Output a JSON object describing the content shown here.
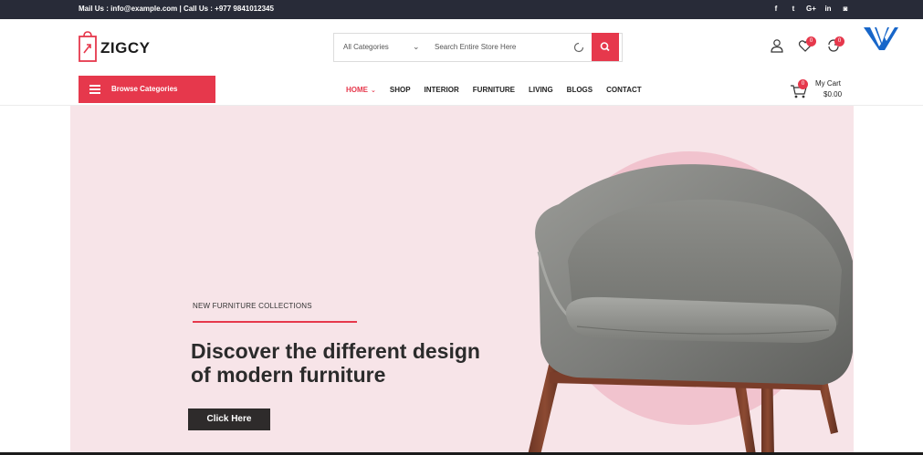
{
  "topbar": {
    "contact_text": "Mail Us : info@example.com | Call Us : +977 9841012345",
    "social": [
      {
        "icon": "facebook-icon",
        "glyph": "f"
      },
      {
        "icon": "twitter-icon",
        "glyph": "t"
      },
      {
        "icon": "google-plus-icon",
        "glyph": "G+"
      },
      {
        "icon": "linkedin-icon",
        "glyph": "in"
      },
      {
        "icon": "instagram-icon",
        "glyph": "◙"
      }
    ]
  },
  "header": {
    "logo_text": "ZIGCY",
    "search": {
      "category_label": "All Categories",
      "placeholder": "Search Entire Store Here"
    },
    "wishlist_count": "0",
    "compare_count": "0"
  },
  "nav": {
    "browse_label": "Browse Categories",
    "items": [
      {
        "label": "HOME",
        "active": true
      },
      {
        "label": "SHOP"
      },
      {
        "label": "INTERIOR"
      },
      {
        "label": "FURNITURE"
      },
      {
        "label": "LIVING"
      },
      {
        "label": "BLOGS"
      },
      {
        "label": "CONTACT"
      }
    ],
    "cart": {
      "count": "0",
      "label": "My Cart",
      "total": "$0.00"
    }
  },
  "hero": {
    "subtitle": "NEW FURNITURE COLLECTIONS",
    "title_line1": "Discover the different design",
    "title_line2": "of modern furniture",
    "button_label": "Click Here"
  },
  "colors": {
    "accent": "#e6384c",
    "topbar": "#282b38",
    "hero_bg": "#f7e4e8",
    "hero_circle": "#f1c3ce",
    "button_dark": "#2e2b2b"
  }
}
